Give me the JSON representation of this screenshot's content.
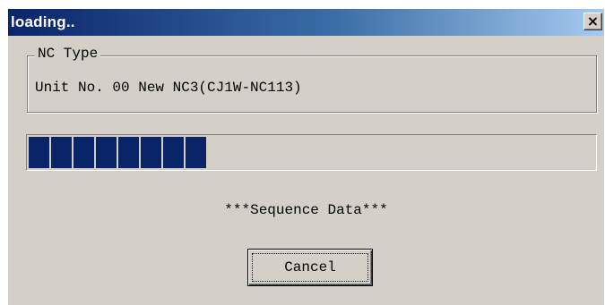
{
  "window": {
    "title": "loading..",
    "close_glyph": "×"
  },
  "nc_type": {
    "legend": "NC Type",
    "unit_text": "Unit No. 00 New NC3(CJ1W-NC113)"
  },
  "progress": {
    "filled_blocks": 8,
    "total_blocks": 25,
    "bar_color": "#0a246a"
  },
  "status": {
    "text": "***Sequence Data***"
  },
  "buttons": {
    "cancel_label": "Cancel"
  },
  "colors": {
    "title_gradient_start": "#0a246a",
    "title_gradient_end": "#a6caf0",
    "window_bg": "#d4d0c8"
  }
}
